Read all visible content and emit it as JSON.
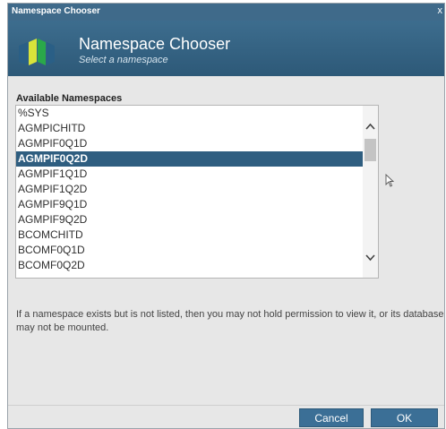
{
  "window": {
    "title": "Namespace Chooser",
    "close_glyph": "x"
  },
  "banner": {
    "heading": "Namespace Chooser",
    "subheading": "Select a namespace",
    "logo_icon": "namespace-logo-icon"
  },
  "namespaces": {
    "label": "Available Namespaces",
    "items": [
      "%SYS",
      "AGMPICHITD",
      "AGMPIF0Q1D",
      "AGMPIF0Q2D",
      "AGMPIF1Q1D",
      "AGMPIF1Q2D",
      "AGMPIF9Q1D",
      "AGMPIF9Q2D",
      "BCOMCHITD",
      "BCOMF0Q1D",
      "BCOMF0Q2D"
    ],
    "selected": "AGMPIF0Q2D"
  },
  "info": {
    "text": "If a namespace exists but is not listed, then you may not hold permission to view it, or its database may not be mounted."
  },
  "buttons": {
    "cancel_label": "Cancel",
    "ok_label": "OK"
  },
  "colors": {
    "titlebar": "#3f6a8a",
    "banner": "#2d5978",
    "selection": "#2f5e80",
    "button": "#3b6f96",
    "logo_yellow": "#d8e33a",
    "logo_green": "#2aa84a",
    "logo_blue": "#2a5f86"
  }
}
